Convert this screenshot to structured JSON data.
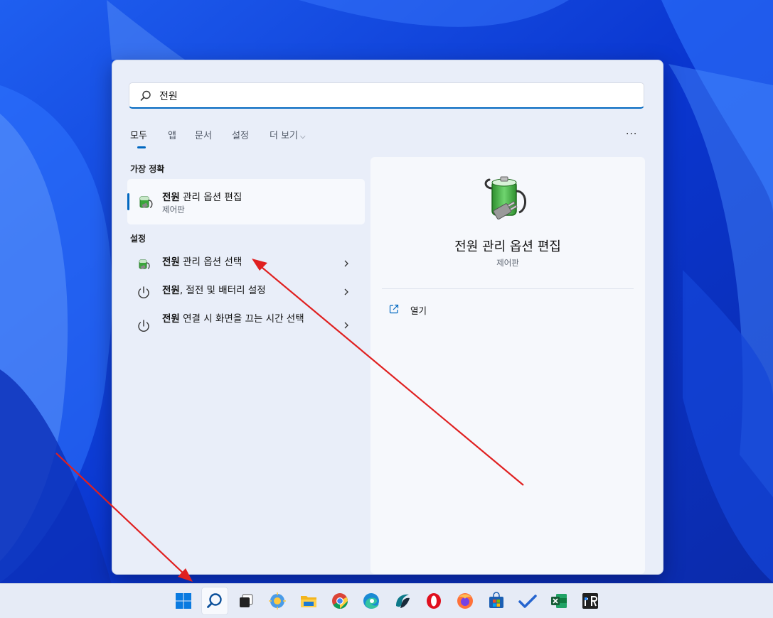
{
  "search": {
    "value": "전원",
    "placeholder": ""
  },
  "tabs": [
    {
      "label": "모두",
      "active": true
    },
    {
      "label": "앱"
    },
    {
      "label": "문서"
    },
    {
      "label": "설정"
    },
    {
      "label": "더 보기"
    }
  ],
  "more_menu": "···",
  "best_match": {
    "section": "가장 정확",
    "keyword": "전원",
    "rest": " 관리 옵션 편집",
    "subtitle": "제어판",
    "icon": "power-options-battery-icon"
  },
  "settings": {
    "section": "설정",
    "items": [
      {
        "keyword": "전원",
        "rest": " 관리 옵션 선택",
        "icon": "power-options-battery-icon"
      },
      {
        "keyword": "전원",
        "rest": ", 절전 및 배터리 설정",
        "icon": "power-icon"
      },
      {
        "keyword": "전원",
        "rest": " 연결 시 화면을 끄는 시간 선택",
        "icon": "power-icon"
      }
    ]
  },
  "detail": {
    "title": "전원 관리 옵션 편집",
    "subtitle": "제어판",
    "action": "열기",
    "icon": "power-options-battery-icon"
  },
  "taskbar": {
    "apps": [
      "start-icon",
      "search-icon",
      "task-view-icon",
      "widgets-icon",
      "file-explorer-icon",
      "chrome-icon",
      "edge-icon",
      "app-icon",
      "opera-icon",
      "firefox-icon",
      "store-icon",
      "todo-icon",
      "excel-icon",
      "rr-app-icon"
    ]
  },
  "colors": {
    "accent": "#0067c0",
    "annotation_arrow": "#e02020"
  }
}
